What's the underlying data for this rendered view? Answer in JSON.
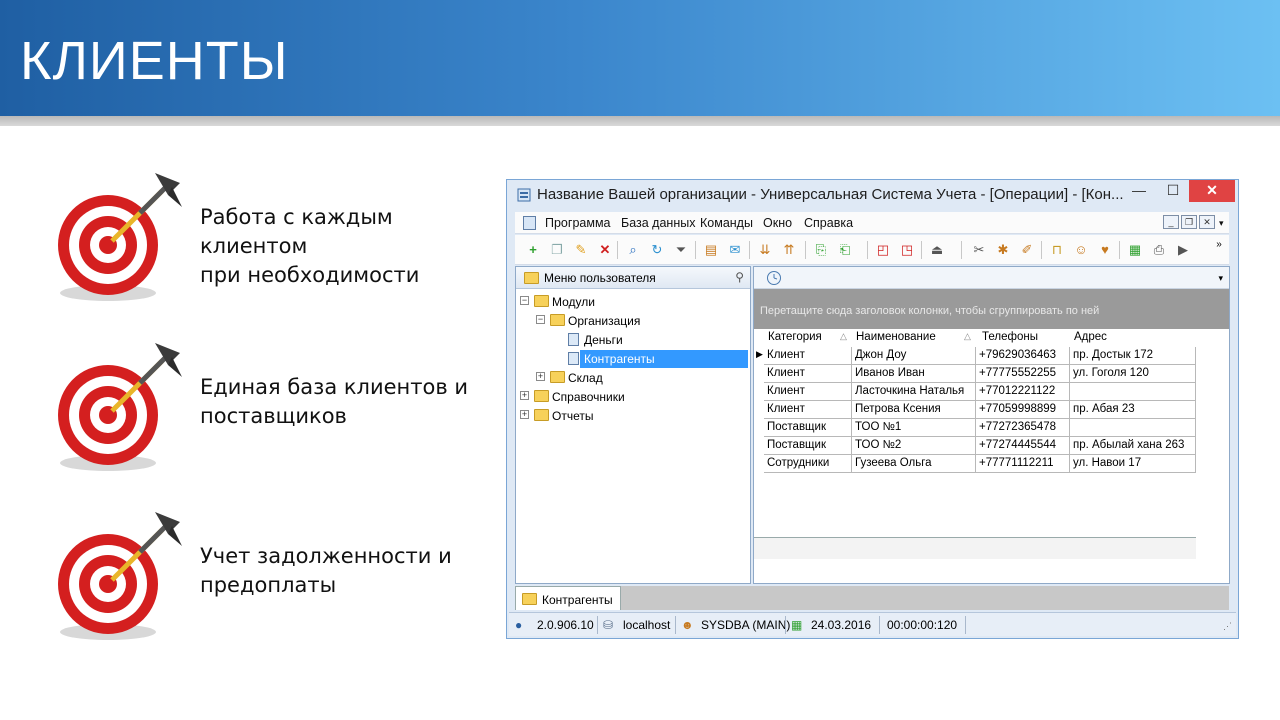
{
  "slide": {
    "title": "КЛИЕНТЫ",
    "bullets": [
      {
        "line1": "Работа с каждым клиентом",
        "line2": "при необходимости"
      },
      {
        "line1": "Единая база клиентов и",
        "line2": "поставщиков"
      },
      {
        "line1": "Учет задолженности и",
        "line2": "предоплаты"
      }
    ]
  },
  "window": {
    "title": "Название Вашей организации - Универсальная Система Учета - [Операции] - [Кон...",
    "min_glyph": "—",
    "max_glyph": "☐",
    "close_glyph": "✕"
  },
  "menu": {
    "items": [
      "Программа",
      "База данных",
      "Команды",
      "Окно",
      "Справка"
    ]
  },
  "left_panel": {
    "header": "Меню пользователя",
    "tree": [
      {
        "label": "Модули",
        "level": 0,
        "expander": "−",
        "icon": "folder"
      },
      {
        "label": "Организация",
        "level": 1,
        "expander": "−",
        "icon": "folder"
      },
      {
        "label": "Деньги",
        "level": 2,
        "expander": "",
        "icon": "doc"
      },
      {
        "label": "Контрагенты",
        "level": 2,
        "expander": "",
        "icon": "doc",
        "selected": true
      },
      {
        "label": "Склад",
        "level": 1,
        "expander": "+",
        "icon": "folder"
      },
      {
        "label": "Справочники",
        "level": 0,
        "expander": "+",
        "icon": "folder"
      },
      {
        "label": "Отчеты",
        "level": 0,
        "expander": "+",
        "icon": "folder"
      }
    ]
  },
  "grid": {
    "group_hint": "Перетащите сюда заголовок колонки, чтобы сгруппировать по ней",
    "columns": [
      "Категория",
      "Наименование",
      "Телефоны",
      "Адрес"
    ],
    "rows": [
      [
        "Клиент",
        "Джон Доу",
        "+79629036463",
        "пр. Достык 172"
      ],
      [
        "Клиент",
        "Иванов Иван",
        "+77775552255",
        "ул. Гоголя 120"
      ],
      [
        "Клиент",
        "Ласточкина Наталья",
        "+77012221122",
        ""
      ],
      [
        "Клиент",
        "Петрова Ксения",
        "+77059998899",
        "пр. Абая 23"
      ],
      [
        "Поставщик",
        "ТОО №1",
        "+77272365478",
        ""
      ],
      [
        "Поставщик",
        "ТОО №2",
        "+77274445544",
        "пр. Абылай хана 263"
      ],
      [
        "Сотрудники",
        "Гузеева Ольга",
        "+77771112211",
        "ул. Навои 17"
      ]
    ]
  },
  "tab": {
    "label": "Контрагенты"
  },
  "status": {
    "version": "2.0.906.10",
    "server": "localhost",
    "user": "SYSDBA (MAIN)",
    "date": "24.03.2016",
    "timer": "00:00:00:120"
  }
}
